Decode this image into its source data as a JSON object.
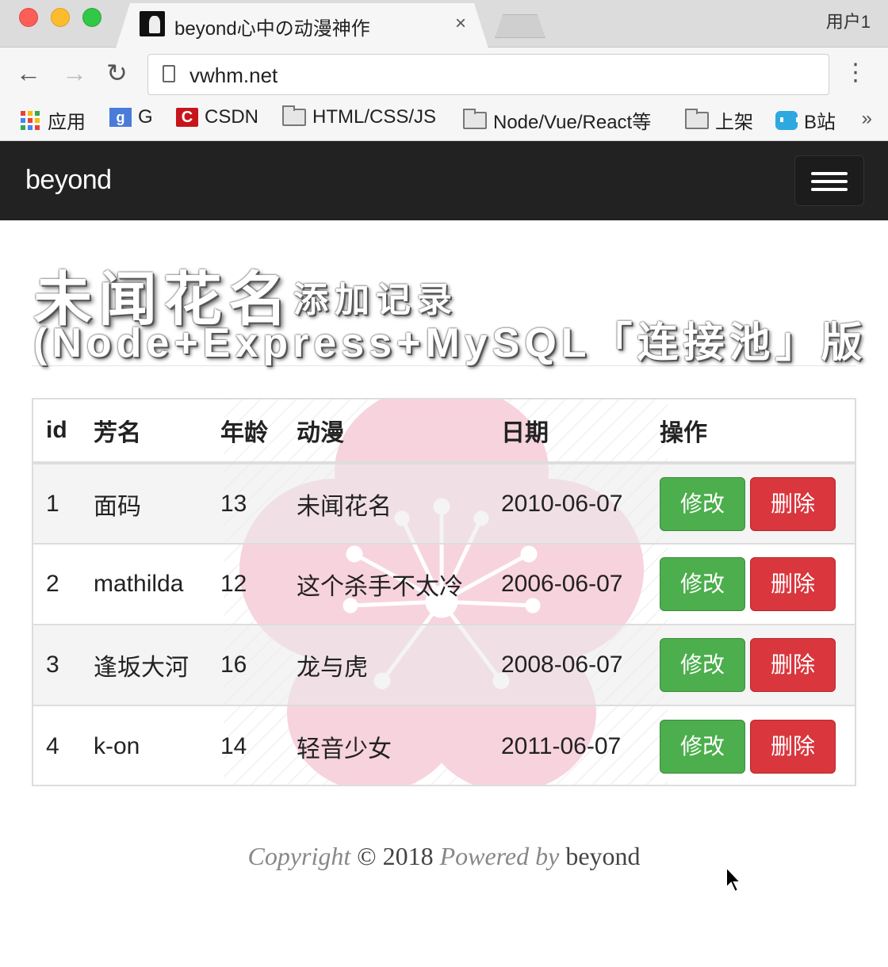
{
  "browser": {
    "tab_title": "beyond心中の动漫神作",
    "tab_close": "×",
    "profile": "用户1",
    "url": "vwhm.net",
    "bookmarks": [
      {
        "label": "应用",
        "icon": "apps-grid-icon"
      },
      {
        "label": "G",
        "icon": "google-icon"
      },
      {
        "label": "CSDN",
        "icon": "csdn-icon"
      },
      {
        "label": "HTML/CSS/JS",
        "icon": "folder-icon"
      },
      {
        "label": "Node/Vue/React等",
        "icon": "folder-icon"
      },
      {
        "label": "上架",
        "icon": "folder-icon"
      },
      {
        "label": "B站",
        "icon": "bilibili-icon"
      }
    ],
    "bookmarks_more": "»"
  },
  "navbar": {
    "brand": "beyond"
  },
  "header": {
    "title": "未闻花名",
    "subtitle": "添加记录",
    "line2": "(Node+Express+MySQL「连接池」版"
  },
  "table": {
    "columns": [
      "id",
      "芳名",
      "年龄",
      "动漫",
      "日期",
      "操作"
    ],
    "rows": [
      {
        "id": "1",
        "name": "面码",
        "age": "13",
        "anime": "未闻花名",
        "date": "2010-06-07"
      },
      {
        "id": "2",
        "name": "mathilda",
        "age": "12",
        "anime": "这个杀手不太冷",
        "date": "2006-06-07"
      },
      {
        "id": "3",
        "name": "逢坂大河",
        "age": "16",
        "anime": "龙与虎",
        "date": "2008-06-07"
      },
      {
        "id": "4",
        "name": "k-on",
        "age": "14",
        "anime": "轻音少女",
        "date": "2011-06-07"
      }
    ],
    "edit_label": "修改",
    "delete_label": "删除"
  },
  "footer": {
    "copyright": "Copyright",
    "symbol_year": "© 2018",
    "powered": "Powered by",
    "author": "beyond"
  },
  "colors": {
    "navbar_bg": "#222222",
    "edit_button": "#4cae4c",
    "delete_button": "#d9363e",
    "flower": "#f7d3de"
  }
}
